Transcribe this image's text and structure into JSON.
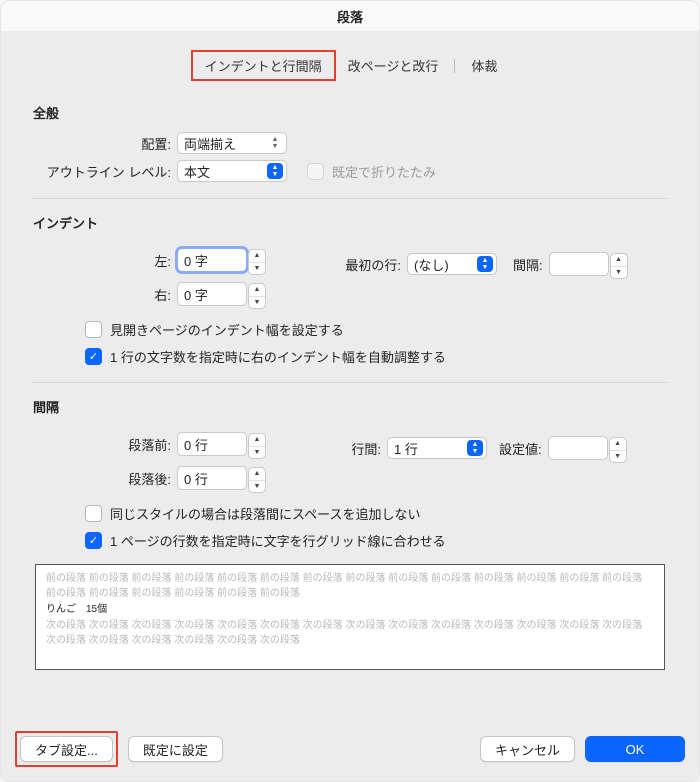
{
  "title": "段落",
  "tabs": {
    "indent": "インデントと行間隔",
    "page": "改ページと改行",
    "layout": "体裁"
  },
  "general": {
    "heading": "全般",
    "alignment_label": "配置:",
    "alignment_value": "両端揃え",
    "outline_label": "アウトライン レベル:",
    "outline_value": "本文",
    "collapse_label": "既定で折りたたみ"
  },
  "indent": {
    "heading": "インデント",
    "left_label": "左:",
    "left_value": "0 字",
    "right_label": "右:",
    "right_value": "0 字",
    "first_label": "最初の行:",
    "first_value": "(なし)",
    "width_label": "間隔:",
    "mirror_label": "見開きページのインデント幅を設定する",
    "auto_label": "1 行の文字数を指定時に右のインデント幅を自動調整する"
  },
  "spacing": {
    "heading": "間隔",
    "before_label": "段落前:",
    "before_value": "0 行",
    "after_label": "段落後:",
    "after_value": "0 行",
    "ls_label": "行間:",
    "ls_value": "1 行",
    "at_label": "設定値:",
    "suppress_label": "同じスタイルの場合は段落間にスペースを追加しない",
    "snap_label": "1 ページの行数を指定時に文字を行グリッド線に合わせる"
  },
  "preview": {
    "before": "前の段落 前の段落 前の段落 前の段落 前の段落 前の段落 前の段落 前の段落 前の段落 前の段落 前の段落 前の段落 前の段落 前の段落 前の段落 前の段落 前の段落 前の段落 前の段落 前の段落",
    "sample": "りんご　15個",
    "after": "次の段落 次の段落 次の段落 次の段落 次の段落 次の段落 次の段落 次の段落 次の段落 次の段落 次の段落 次の段落 次の段落 次の段落 次の段落 次の段落 次の段落 次の段落 次の段落 次の段落"
  },
  "footer": {
    "tabs": "タブ設定...",
    "default": "既定に設定",
    "cancel": "キャンセル",
    "ok": "OK"
  }
}
